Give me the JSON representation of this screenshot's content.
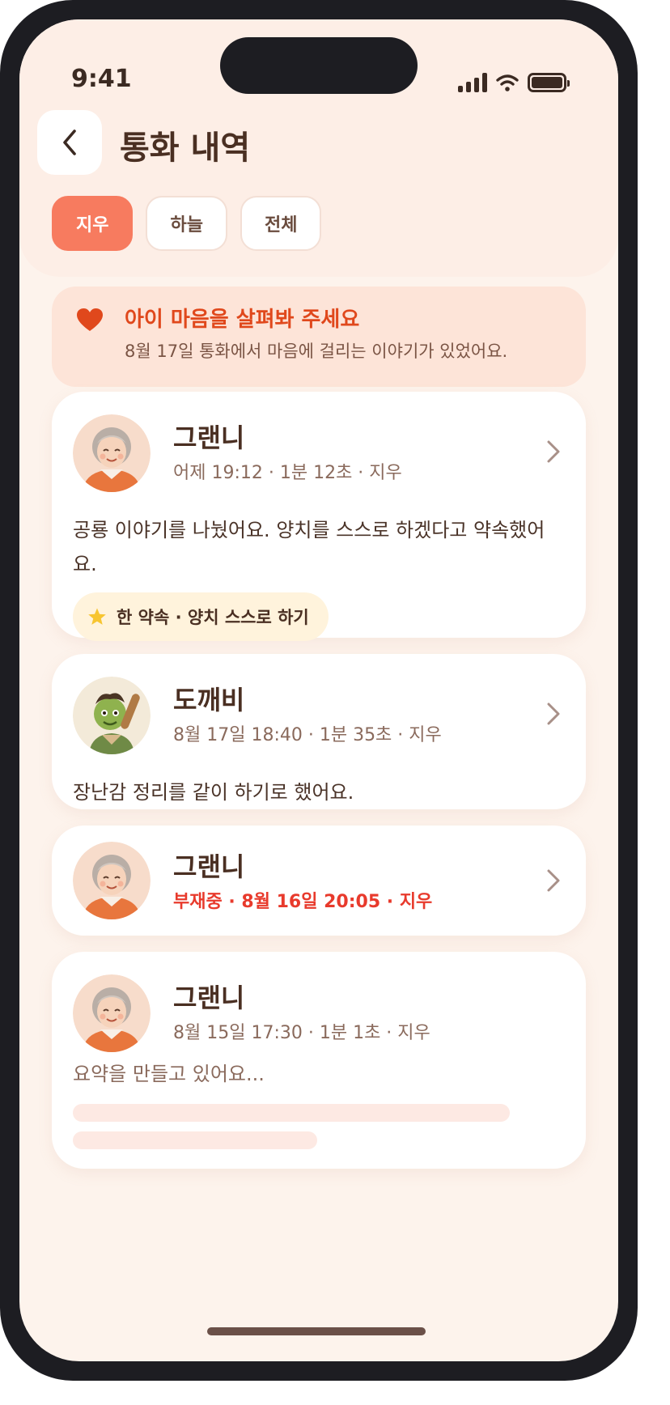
{
  "status_bar": {
    "time": "9:41"
  },
  "header": {
    "title": "통화 내역",
    "tabs": [
      {
        "label": "지우",
        "active": true
      },
      {
        "label": "하늘",
        "active": false
      },
      {
        "label": "전체",
        "active": false
      }
    ]
  },
  "alert": {
    "title": "아이 마음을 살펴봐 주세요",
    "text": "8월 17일 통화에서 마음에 걸리는 이야기가 있었어요.",
    "icon": "heart-icon",
    "color": "#e0481c"
  },
  "calls": [
    {
      "name": "그랜니",
      "meta": "어제 19:12 · 1분 12초 · 지우",
      "summary": "공룡 이야기를 나눴어요. 양치를 스스로 하겠다고 약속했어요.",
      "promise": "한 약속 · 양치 스스로 하기",
      "avatar": "granny-avatar"
    },
    {
      "name": "도깨비",
      "meta": "8월 17일 18:40 · 1분 35초 · 지우",
      "summary": "장난감 정리를 같이 하기로 했어요.",
      "avatar": "goblin-avatar"
    },
    {
      "name": "그랜니",
      "meta": "부재중 · 8월 16일 20:05 · 지우",
      "missed": true,
      "avatar": "granny-avatar"
    },
    {
      "name": "그랜니",
      "meta": "8월 15일 17:30 · 1분 1초 · 지우",
      "summary": "요약을 만들고 있어요...",
      "loading": true,
      "avatar": "granny-avatar"
    }
  ],
  "colors": {
    "accent": "#f77b5f",
    "missed": "#e83a2c",
    "background": "#fdf3ec"
  }
}
